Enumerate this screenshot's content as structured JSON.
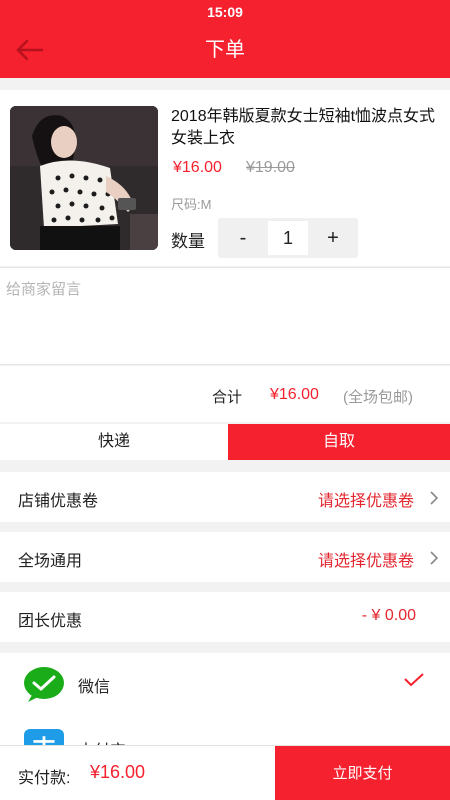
{
  "status_bar": {
    "time": "15:09"
  },
  "nav": {
    "title": "下单",
    "back_icon": "arrow-left-icon"
  },
  "product": {
    "name": "2018年韩版夏款女士短袖t恤波点女式女装上衣",
    "price": "¥16.00",
    "original_price": "¥19.00",
    "spec": "尺码:M",
    "quantity_label": "数量",
    "quantity": "1",
    "minus": "-",
    "plus": "+"
  },
  "message": {
    "placeholder": "给商家留言"
  },
  "total": {
    "label": "合计",
    "amount": "¥16.00",
    "note": "(全场包邮)"
  },
  "delivery": {
    "options": [
      "快递",
      "自取"
    ],
    "selected": "自取"
  },
  "coupons": [
    {
      "label": "店铺优惠卷",
      "value": "请选择优惠卷"
    },
    {
      "label": "全场通用",
      "value": "请选择优惠卷"
    },
    {
      "label": "团长优惠",
      "value": "- ¥ 0.00"
    }
  ],
  "payment": {
    "methods": [
      {
        "label": "微信",
        "icon": "wechat-icon",
        "selected": true
      },
      {
        "label": "支付宝",
        "icon": "alipay-icon",
        "selected": false
      }
    ]
  },
  "footer": {
    "label": "实付款:",
    "amount": "¥16.00",
    "pay_button": "立即支付"
  },
  "colors": {
    "accent": "#f5212f",
    "wechat": "#1aad19",
    "alipay": "#1e9ce8"
  }
}
